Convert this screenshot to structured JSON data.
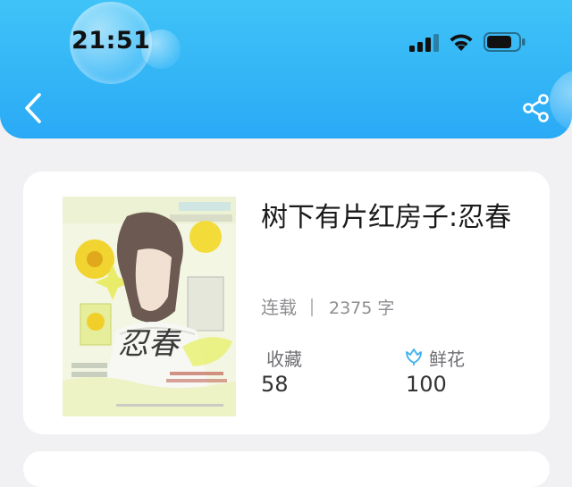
{
  "status_bar": {
    "time": "21:51"
  },
  "colors": {
    "header": "#2aaaf6",
    "accent": "#3ab0f0",
    "card": "#ffffff",
    "background": "#f1f1f3"
  },
  "icons": {
    "back": "chevron-left-icon",
    "share": "share-icon",
    "flower": "flower-icon"
  },
  "book": {
    "title": "树下有片红房子:忍春",
    "status": "连载",
    "word_count": "2375 字",
    "favorites_label": "收藏",
    "favorites_value": "58",
    "flowers_label": "鲜花",
    "flowers_value": "100",
    "cover_text": "忍春"
  }
}
